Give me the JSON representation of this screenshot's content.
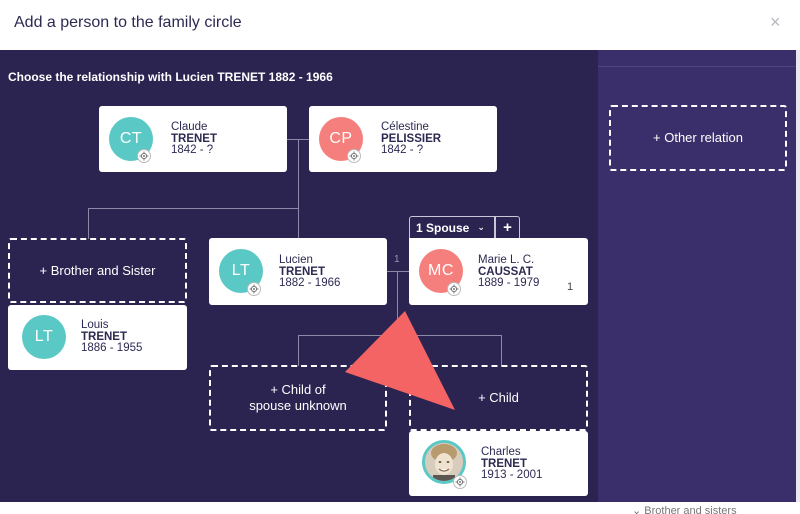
{
  "header": {
    "title": "Add a person to the family circle",
    "close_glyph": "×"
  },
  "subtitle": "Choose the relationship with Lucien TRENET 1882 - 1966",
  "colors": {
    "tree_bg": "#2b2350",
    "side_bg": "#3a2f6a",
    "male": "#5ac8c4",
    "female": "#f47f7c",
    "arrow": "#f46464"
  },
  "persons": {
    "father": {
      "initials": "CT",
      "first": "Claude",
      "last": "TRENET",
      "dates": "1842 - ?"
    },
    "mother": {
      "initials": "CP",
      "first": "Célestine",
      "last": "PELISSIER",
      "dates": "1842 - ?"
    },
    "self": {
      "initials": "LT",
      "first": "Lucien",
      "last": "TRENET",
      "dates": "1882 - 1966"
    },
    "spouse": {
      "initials": "MC",
      "first": "Marie L. C.",
      "last": "CAUSSAT",
      "dates": "1889 - 1979",
      "count": "1"
    },
    "sibling": {
      "initials": "LT",
      "first": "Louis",
      "last": "TRENET",
      "dates": "1886 - 1955"
    },
    "child": {
      "first": "Charles",
      "last": "TRENET",
      "dates": "1913 - 2001"
    }
  },
  "actions": {
    "other_relation": "+ Other relation",
    "brother_sister": "+ Brother and Sister",
    "child_unknown_line1": "+ Child of",
    "child_unknown_line2": "spouse unknown",
    "child": "+ Child"
  },
  "spouse_selector": {
    "label": "1 Spouse",
    "chevron": "⌄",
    "add": "+"
  },
  "connector_number": "1",
  "bottom_peek": "⌄ Brother and sisters"
}
